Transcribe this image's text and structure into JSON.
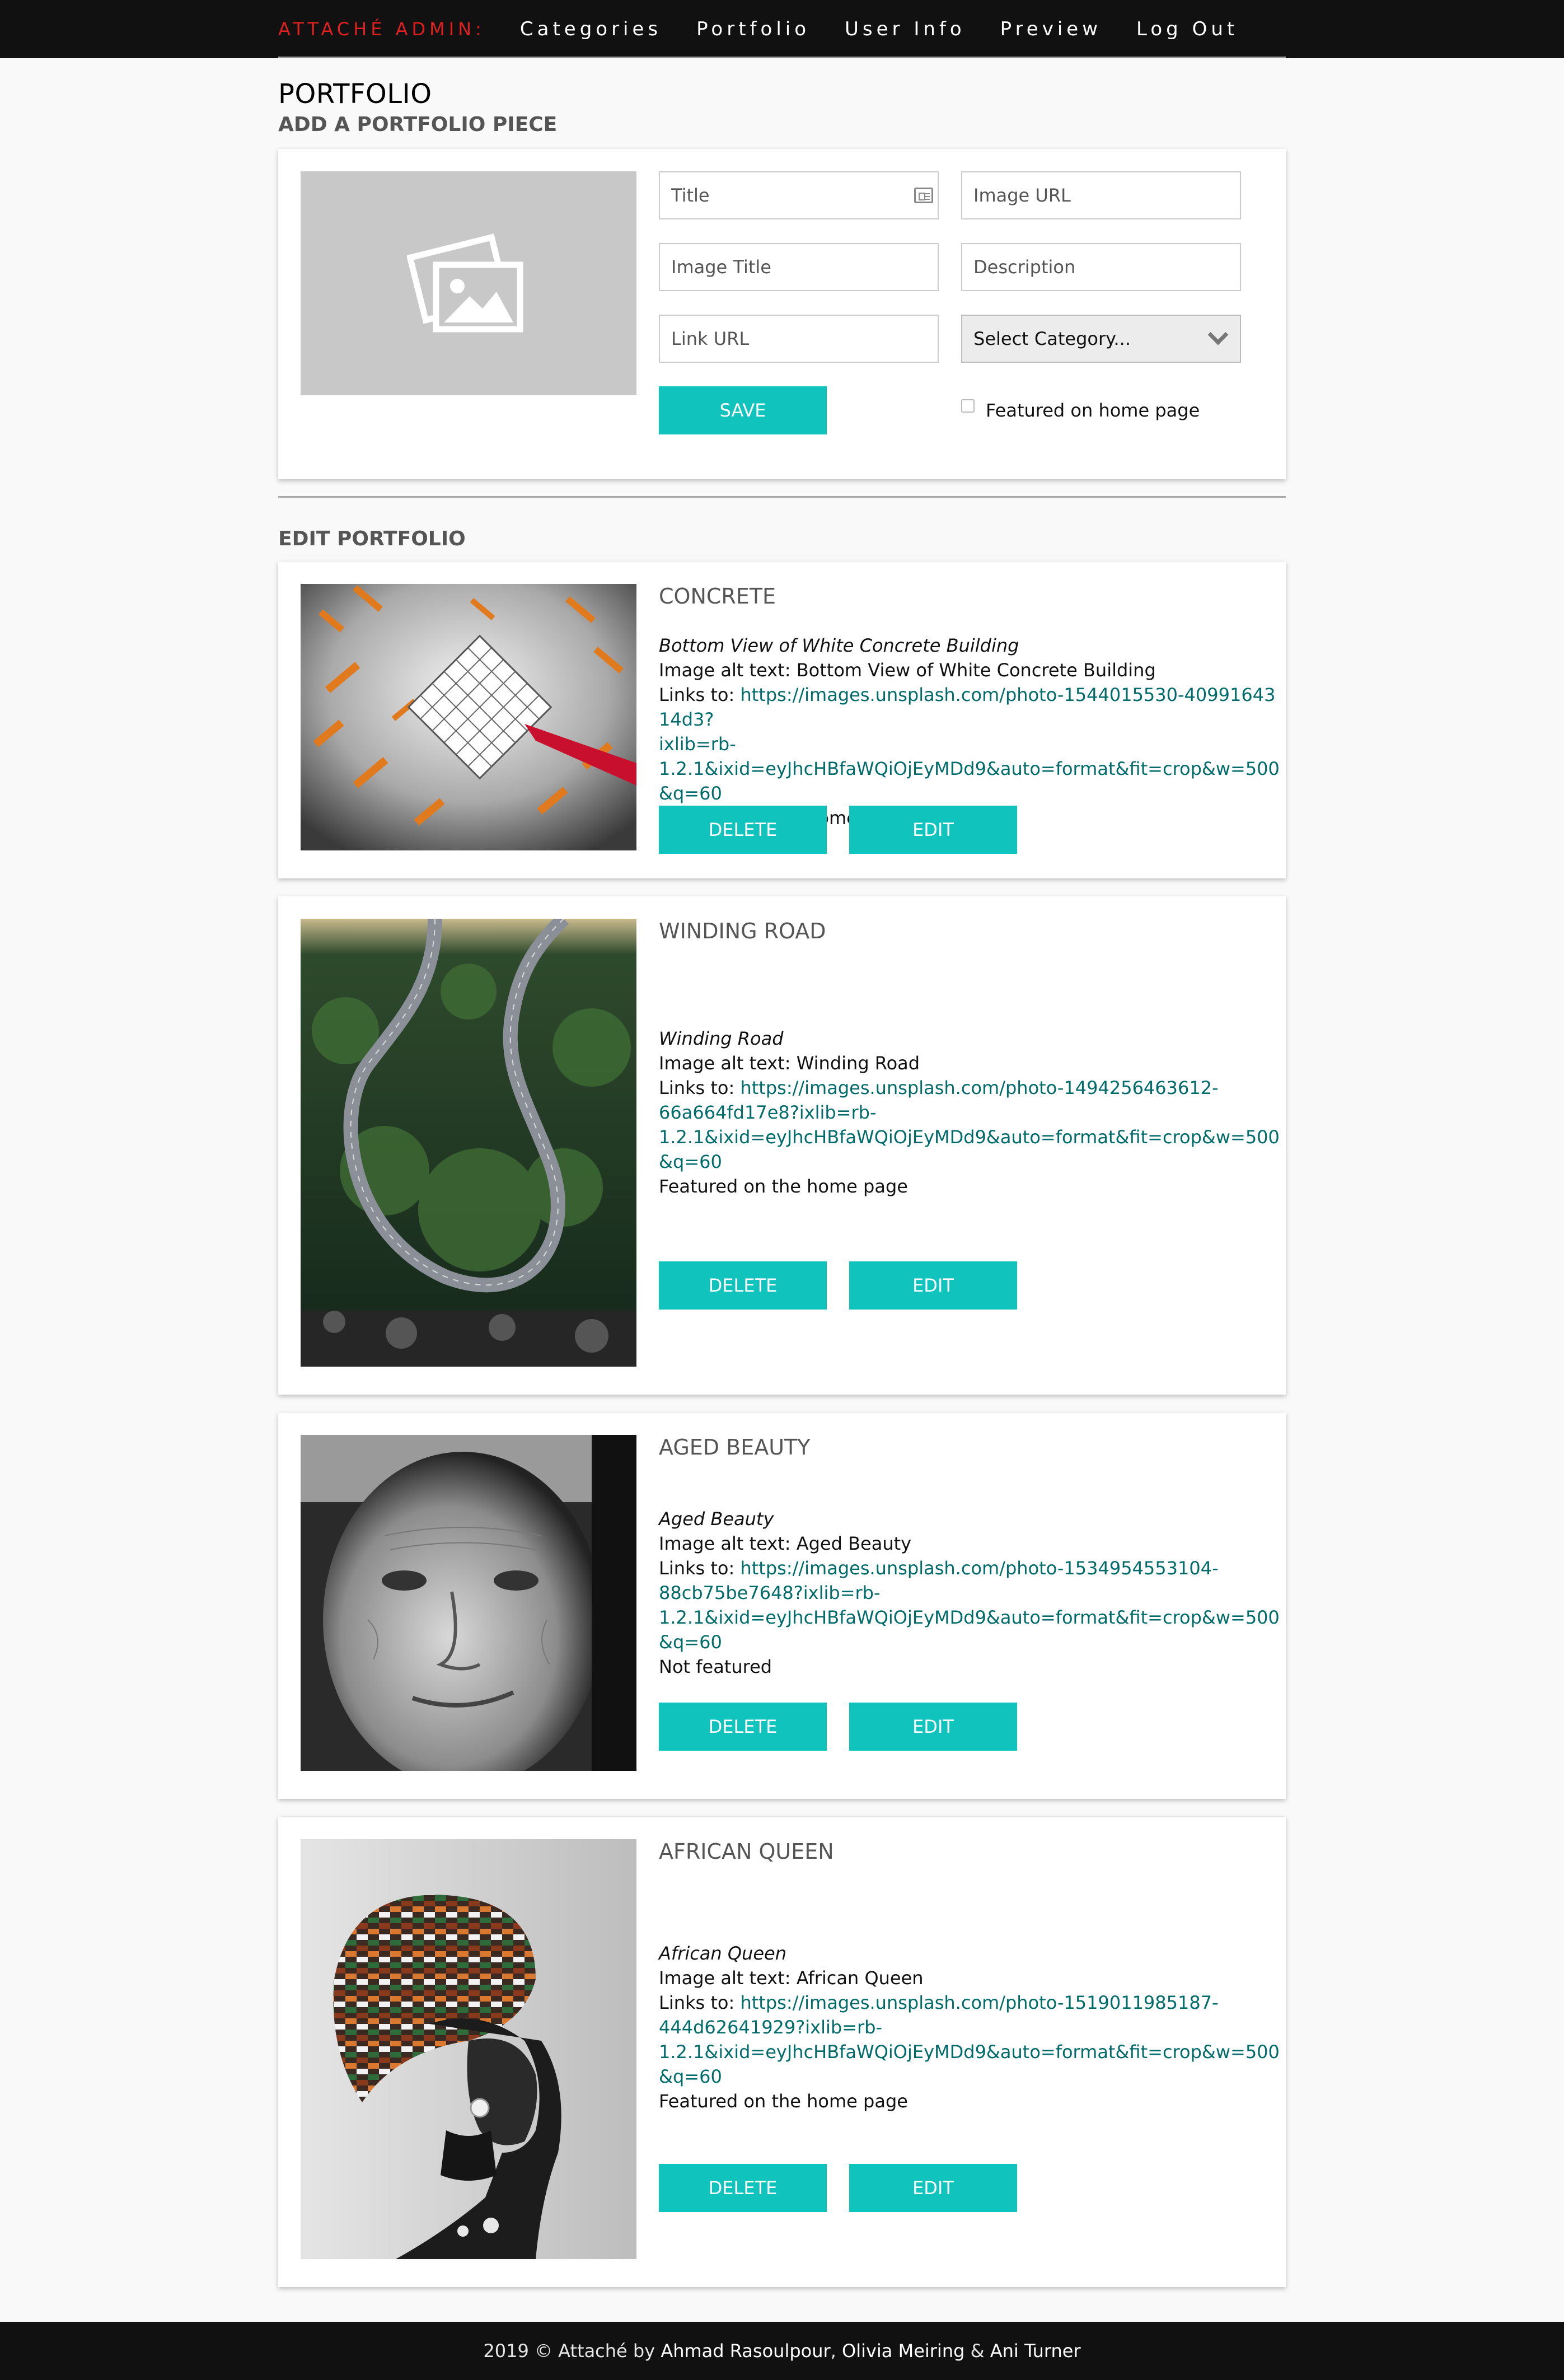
{
  "nav": {
    "brand": "ATTACHÉ ADMIN:",
    "links": [
      "Categories",
      "Portfolio",
      "User Info",
      "Preview",
      "Log Out"
    ]
  },
  "page": {
    "title": "PORTFOLIO",
    "add_heading": "ADD A PORTFOLIO PIECE",
    "edit_heading": "EDIT PORTFOLIO"
  },
  "form": {
    "title_placeholder": "Title",
    "image_url_placeholder": "Image URL",
    "image_title_placeholder": "Image Title",
    "description_placeholder": "Description",
    "link_url_placeholder": "Link URL",
    "category_selected": "Select Category...",
    "featured_label": "Featured on home page",
    "save_label": "SAVE"
  },
  "items": [
    {
      "title": "CONCRETE",
      "image_title": "Bottom View of White Concrete Building",
      "alt_label": "Image alt text: ",
      "alt_text": "Bottom View of White Concrete Building",
      "links_label": "Links to: ",
      "link": "https://images.unsplash.com/photo-1544015530-4099164314d3?ixlib=rb-1.2.1&ixid=eyJhcHBfaWQiOjEyMDd9&auto=format&fit=crop&w=500&q=60",
      "link_lines": [
        "https://images.unsplash.com/photo-1544015530-4099164314d3?",
        "ixlib=rb-",
        "1.2.1&ixid=eyJhcHBfaWQiOjEyMDd9&auto=format&fit=crop&w=500&q=60"
      ],
      "featured": "Featured on the home page",
      "delete_label": "DELETE",
      "edit_label": "EDIT"
    },
    {
      "title": "WINDING ROAD",
      "image_title": "Winding Road",
      "alt_label": "Image alt text: ",
      "alt_text": "Winding Road",
      "links_label": "Links to: ",
      "link": "https://images.unsplash.com/photo-1494256463612-66a664fd17e8?ixlib=rb-1.2.1&ixid=eyJhcHBfaWQiOjEyMDd9&auto=format&fit=crop&w=500&q=60",
      "link_lines": [
        "https://images.unsplash.com/photo-1494256463612-",
        "66a664fd17e8?ixlib=rb-",
        "1.2.1&ixid=eyJhcHBfaWQiOjEyMDd9&auto=format&fit=crop&w=500&q=60"
      ],
      "featured": "Featured on the home page",
      "delete_label": "DELETE",
      "edit_label": "EDIT"
    },
    {
      "title": "AGED BEAUTY",
      "image_title": "Aged Beauty",
      "alt_label": "Image alt text: ",
      "alt_text": "Aged Beauty",
      "links_label": "Links to: ",
      "link": "https://images.unsplash.com/photo-1534954553104-88cb75be7648?ixlib=rb-1.2.1&ixid=eyJhcHBfaWQiOjEyMDd9&auto=format&fit=crop&w=500&q=60",
      "link_lines": [
        "https://images.unsplash.com/photo-1534954553104-",
        "88cb75be7648?ixlib=rb-",
        "1.2.1&ixid=eyJhcHBfaWQiOjEyMDd9&auto=format&fit=crop&w=500&q=60"
      ],
      "featured": "Not featured",
      "delete_label": "DELETE",
      "edit_label": "EDIT"
    },
    {
      "title": "AFRICAN QUEEN",
      "image_title": "African Queen",
      "alt_label": "Image alt text: ",
      "alt_text": "African Queen",
      "links_label": "Links to: ",
      "link": "https://images.unsplash.com/photo-1519011985187-444d62641929?ixlib=rb-1.2.1&ixid=eyJhcHBfaWQiOjEyMDd9&auto=format&fit=crop&w=500&q=60",
      "link_lines": [
        "https://images.unsplash.com/photo-1519011985187-",
        "444d62641929?ixlib=rb-",
        "1.2.1&ixid=eyJhcHBfaWQiOjEyMDd9&auto=format&fit=crop&w=500&q=60"
      ],
      "featured": "Featured on the home page",
      "delete_label": "DELETE",
      "edit_label": "EDIT"
    }
  ],
  "footer": {
    "prefix": "2019 © Attaché by ",
    "name1": "Ahmad Rasoulpour",
    "sep1": ", ",
    "name2": "Olivia Meiring",
    "sep2": " & ",
    "name3": "Ani Turner"
  },
  "colors": {
    "accent": "#10c4bd",
    "brand": "#e02020",
    "nav_bg": "#111111",
    "link": "#006b6b"
  }
}
